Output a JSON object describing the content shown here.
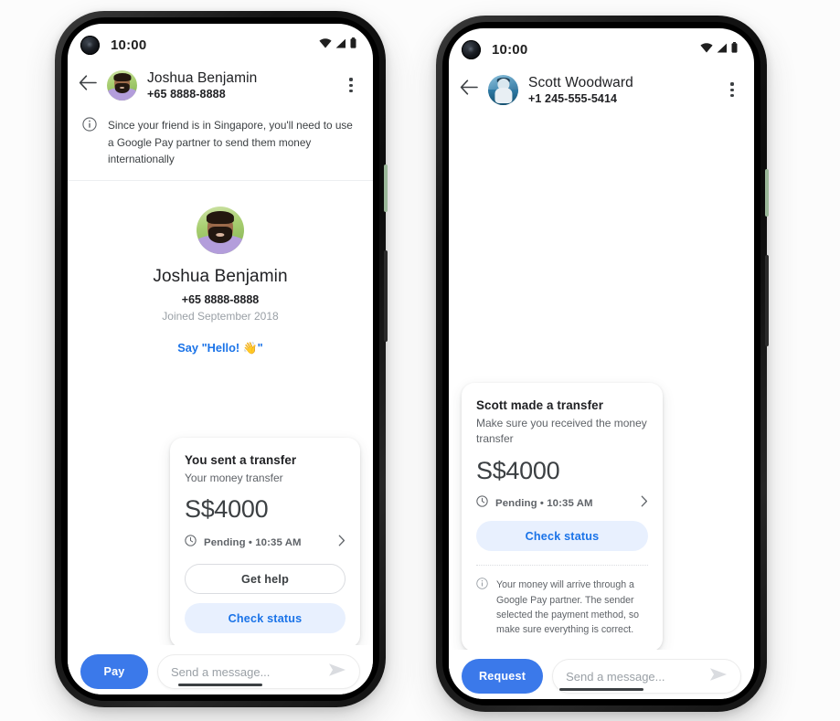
{
  "phones": [
    {
      "id": "phone-sender",
      "status_bar": {
        "time": "10:00",
        "wifi_icon": "wifi-icon",
        "signal_icon": "signal-icon",
        "battery_icon": "battery-icon"
      },
      "app_bar": {
        "back_icon": "back-arrow-icon",
        "avatar": "contact-avatar",
        "contact_name": "Joshua Benjamin",
        "contact_phone": "+65 8888-8888",
        "overflow_icon": "more-options-icon"
      },
      "info_banner": {
        "icon": "info-icon",
        "text": "Since your friend is in Singapore, you'll need to use a Google Pay partner to send them money internationally"
      },
      "hero": {
        "avatar": "profile-avatar",
        "name": "Joshua Benjamin",
        "phone": "+65 8888-8888",
        "joined": "Joined September 2018",
        "say_hello": "Say \"Hello! 👋\""
      },
      "card": {
        "title": "You sent a transfer",
        "subtitle": "Your money transfer",
        "amount": "S$4000",
        "status_icon": "clock-icon",
        "status": "Pending • 10:35 AM",
        "chevron_icon": "chevron-right-icon",
        "secondary_button": "Get help",
        "primary_button": "Check status",
        "has_note": false
      },
      "bottom_bar": {
        "action_label": "Pay",
        "message_placeholder": "Send a message...",
        "send_icon": "send-icon"
      }
    },
    {
      "id": "phone-receiver",
      "status_bar": {
        "time": "10:00",
        "wifi_icon": "wifi-icon",
        "signal_icon": "signal-icon",
        "battery_icon": "battery-icon"
      },
      "app_bar": {
        "back_icon": "back-arrow-icon",
        "avatar": "contact-avatar",
        "contact_name": "Scott Woodward",
        "contact_phone": "+1 245-555-5414",
        "overflow_icon": "more-options-icon"
      },
      "card": {
        "title": "Scott made a transfer",
        "subtitle": "Make sure you received the money transfer",
        "amount": "S$4000",
        "status_icon": "clock-icon",
        "status": "Pending • 10:35 AM",
        "chevron_icon": "chevron-right-icon",
        "primary_button": "Check status",
        "has_note": true,
        "note_icon": "info-icon",
        "note": "Your money will arrive through a Google Pay partner. The sender selected the payment method, so make sure everything is correct."
      },
      "bottom_bar": {
        "action_label": "Request",
        "message_placeholder": "Send a message...",
        "send_icon": "send-icon"
      }
    }
  ],
  "colors": {
    "accent_blue": "#1a73e8",
    "action_blue": "#3b79ea",
    "tonal_blue_bg": "#e8f0fe",
    "text_primary": "#202124",
    "text_secondary": "#5f6368",
    "text_muted": "#9aa0a6",
    "page_background": "#fcfcfc"
  }
}
